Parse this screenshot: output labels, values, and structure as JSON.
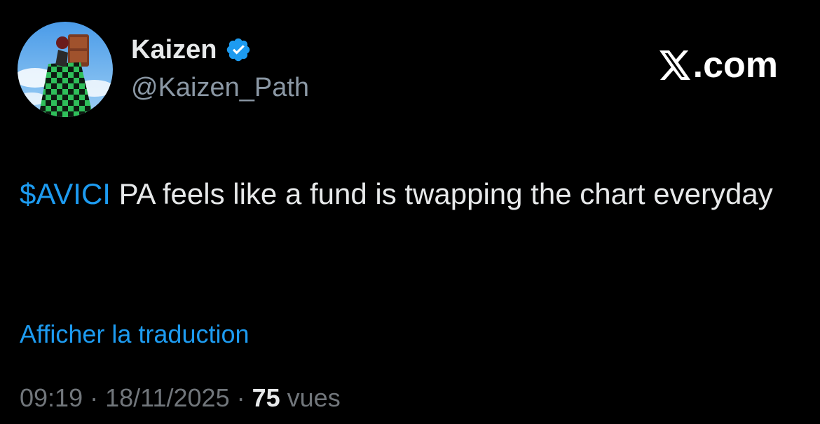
{
  "author": {
    "display_name": "Kaizen",
    "handle": "@Kaizen_Path",
    "verified_icon": "verified-badge-icon",
    "verified_color": "#1d9bf0",
    "avatar_icon": "anime-character-avatar"
  },
  "brand": {
    "logo_icon": "x-logo-icon",
    "text": ".com"
  },
  "tweet": {
    "cashtag": "$AVICI",
    "text": " PA feels like a fund is twapping the chart everyday"
  },
  "translate_link": "Afficher la traduction",
  "meta": {
    "time": "09:19",
    "separator_1": " · ",
    "date": "18/11/2025",
    "separator_2": " · ",
    "views_count": "75",
    "views_label": " vues"
  },
  "colors": {
    "background": "#000000",
    "primary_text": "#e7e9ea",
    "secondary_text": "#71767b",
    "handle_text": "#8b98a5",
    "link": "#1d9bf0"
  }
}
